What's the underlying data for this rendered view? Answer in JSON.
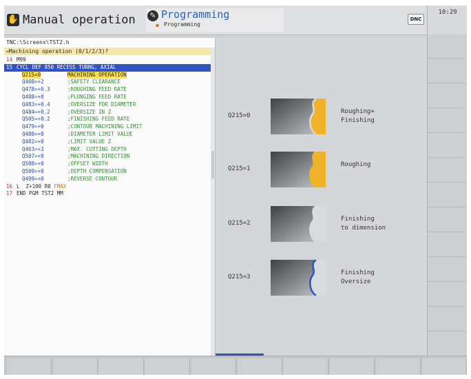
{
  "header": {
    "mode_manual": "Manual operation",
    "mode_programming": "Programming",
    "mode_programming_sub": "Programming",
    "dnc_badge": "DNC",
    "clock": "10:29"
  },
  "program": {
    "path": "TNC:\\Screens\\TST2.h",
    "prompt": "→Machining operation (0/1/2/3)?",
    "lines": [
      {
        "num": "14",
        "text": "M99"
      },
      {
        "num": "15",
        "text": "CYCL DEF 850 RECESS TURNG, AXIAL",
        "selected": true
      },
      {
        "param": "Q215=0",
        "comment": "MACHINING OPERATION",
        "active": true
      },
      {
        "param": "Q460=+2",
        "comment": ";SAFETY CLEARANCE"
      },
      {
        "param": "Q478=+0.3",
        "comment": ";ROUGHING FEED RATE"
      },
      {
        "param": "Q488=+0",
        "comment": ";PLUNGING FEED RATE"
      },
      {
        "param": "Q483=+0.4",
        "comment": ";OVERSIZE FOR DIAMETER"
      },
      {
        "param": "Q484=+0.2",
        "comment": ";OVERSIZE IN Z"
      },
      {
        "param": "Q505=+0.2",
        "comment": ";FINISHING FEED RATE"
      },
      {
        "param": "Q479=+0",
        "comment": ";CONTOUR MACHINING LIMIT"
      },
      {
        "param": "Q480=+0",
        "comment": ";DIAMETER LIMIT VALUE"
      },
      {
        "param": "Q482=+0",
        "comment": ";LIMIT VALUE Z"
      },
      {
        "param": "Q463=+3",
        "comment": ";MAX. CUTTING DEPTH"
      },
      {
        "param": "Q507=+0",
        "comment": ";MACHINING DIRECTION"
      },
      {
        "param": "Q508=+0",
        "comment": ";OFFSET WIDTH"
      },
      {
        "param": "Q509=+0",
        "comment": ";DEPTH COMPENSATION"
      },
      {
        "param": "Q499=+0",
        "comment": ";REVERSE CONTOUR"
      },
      {
        "num": "16",
        "text": "L  Z+100 R0 ",
        "extra": "FMAX"
      },
      {
        "num": "17",
        "text": "END PGM TST2 MM"
      }
    ]
  },
  "help": {
    "options": [
      {
        "label": "Q215=0",
        "desc1": "Roughing+",
        "desc2": "Finishing",
        "fill_color": "#f0b32a",
        "contour_color": "#d9dcde"
      },
      {
        "label": "Q215=1",
        "desc1": "Roughing",
        "desc2": "",
        "fill_color": "#f0b32a",
        "contour_color": "#f0b32a"
      },
      {
        "label": "Q215=2",
        "desc1": "Finishing",
        "desc2": "to dimension",
        "fill_color": "#d9dcde",
        "contour_color": "#d9dcde"
      },
      {
        "label": "Q215=3",
        "desc1": "Finishing",
        "desc2": "Oversize",
        "fill_color": "#d9dcde",
        "contour_color": "#2f52c4"
      }
    ]
  },
  "colors": {
    "selection": "#2f52c4",
    "prompt_bg": "#f7e7a4",
    "roughing_fill": "#f0b32a",
    "finishing_contour": "#2f52c4"
  }
}
